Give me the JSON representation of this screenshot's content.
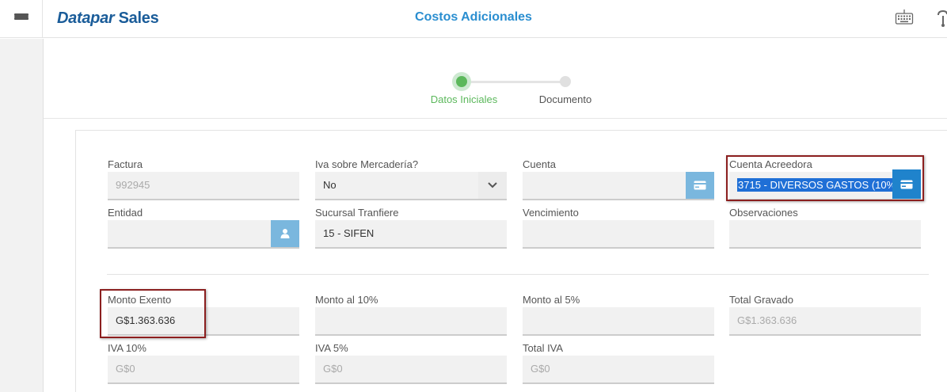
{
  "header": {
    "brand_part1": "Datapar",
    "brand_part2": " Sales",
    "title": "Costos Adicionales"
  },
  "stepper": {
    "steps": [
      {
        "label": "Datos Iniciales",
        "active": true
      },
      {
        "label": "Documento",
        "active": false
      }
    ]
  },
  "form": {
    "factura": {
      "label": "Factura",
      "value": "992945"
    },
    "iva_mercaderia": {
      "label": "Iva sobre Mercadería?",
      "value": "No"
    },
    "cuenta": {
      "label": "Cuenta",
      "value": ""
    },
    "cuenta_acreedora": {
      "label": "Cuenta Acreedora",
      "value": "3715 - DIVERSOS GASTOS (10%"
    },
    "entidad": {
      "label": "Entidad",
      "value": ""
    },
    "sucursal": {
      "label": "Sucursal Tranfiere",
      "value": "15 - SIFEN"
    },
    "vencimiento": {
      "label": "Vencimiento",
      "value": ""
    },
    "observaciones": {
      "label": "Observaciones",
      "value": ""
    },
    "monto_exento": {
      "label": "Monto Exento",
      "value": "G$1.363.636"
    },
    "monto_10": {
      "label": "Monto al 10%",
      "value": ""
    },
    "monto_5": {
      "label": "Monto al 5%",
      "value": ""
    },
    "total_gravado": {
      "label": "Total Gravado",
      "value": "G$1.363.636"
    },
    "iva_10": {
      "label": "IVA 10%",
      "value": "G$0"
    },
    "iva_5": {
      "label": "IVA 5%",
      "value": "G$0"
    },
    "total_iva": {
      "label": "Total IVA",
      "value": "G$0"
    }
  },
  "colors": {
    "brand": "#1a5c99",
    "title": "#2a8ed0",
    "step_active": "#5cb85c",
    "button_dark": "#1f83cc",
    "button_light": "#7ab7de",
    "highlight": "#8b1f1f"
  },
  "icons": {
    "menu": "hamburger-icon",
    "keyboard": "keyboard-icon",
    "card": "credit-card-icon",
    "user": "user-icon",
    "dropdown": "chevron-down-icon"
  }
}
